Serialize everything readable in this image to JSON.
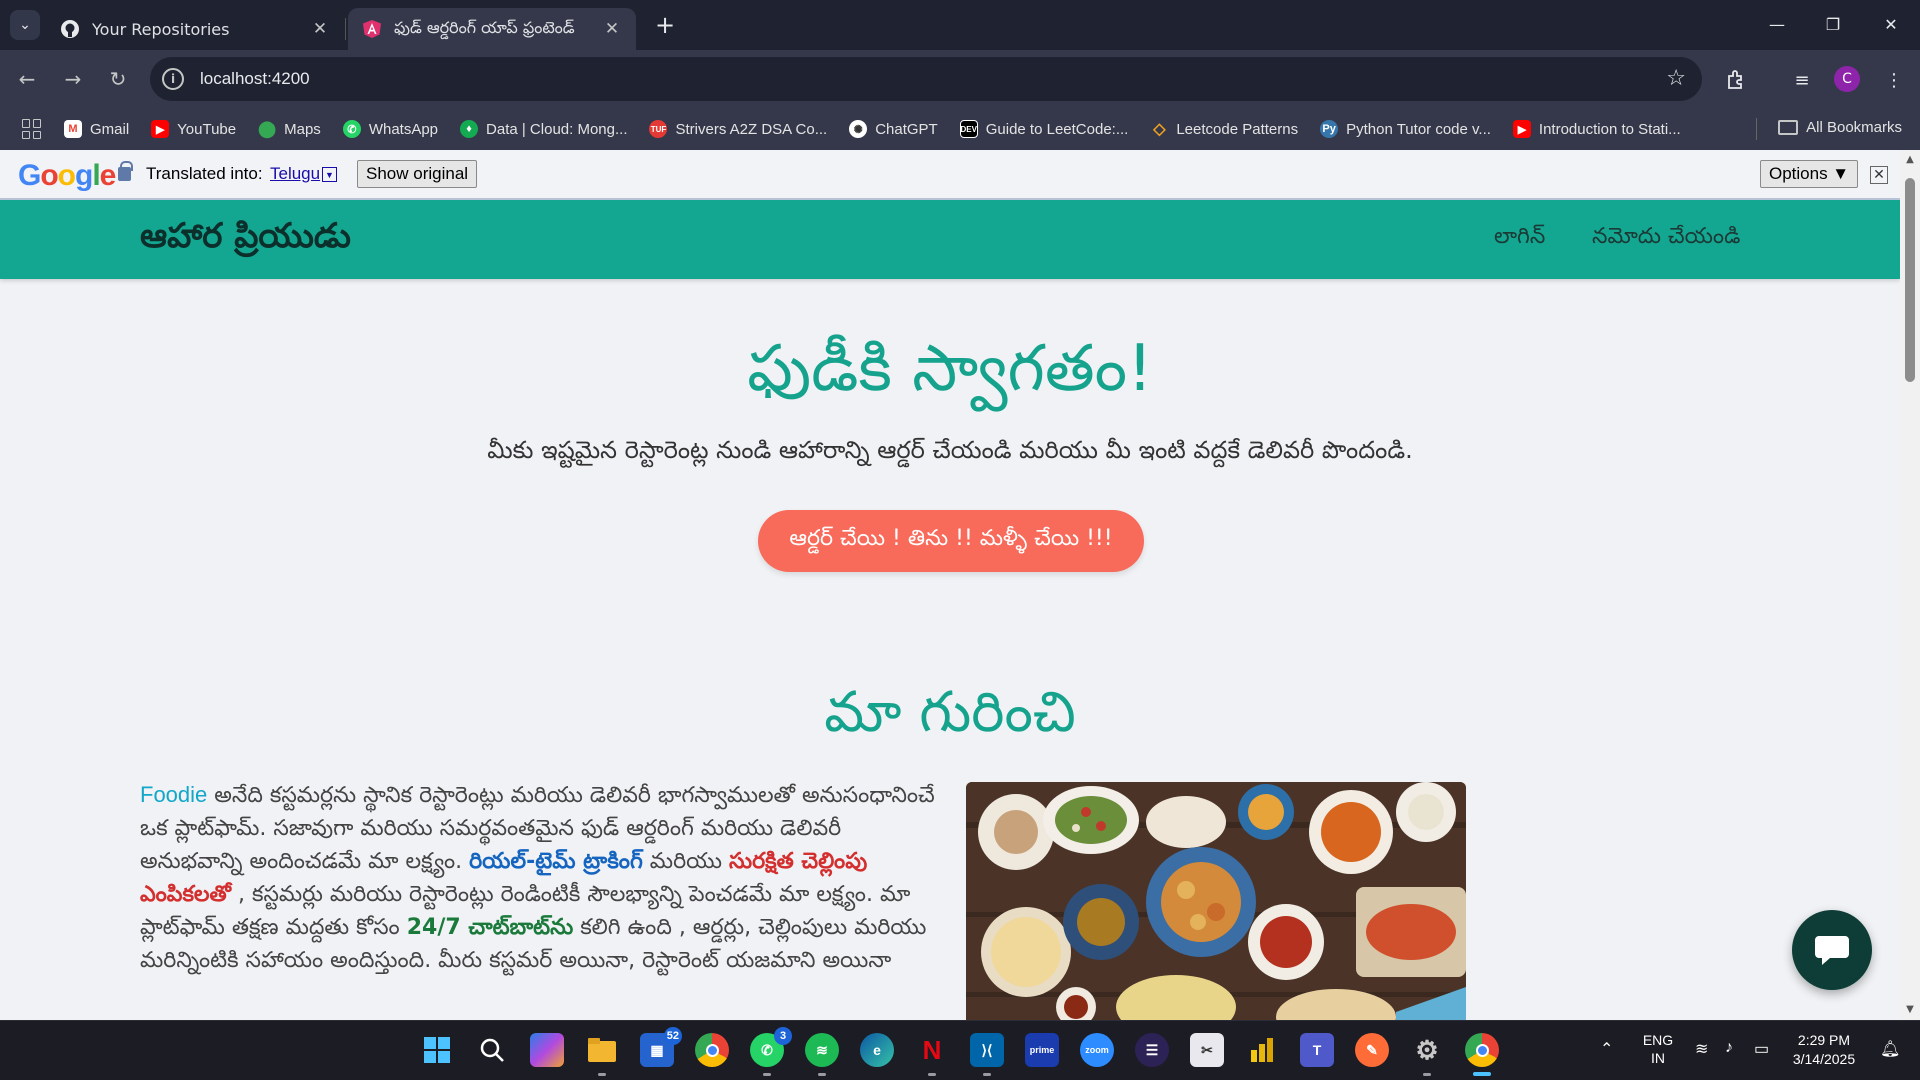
{
  "browser": {
    "tabs": [
      {
        "title": "Your Repositories",
        "icon": "github-icon"
      },
      {
        "title": "ఫుడ్ ఆర్డరింగ్ యాప్ ఫ్రంటెండ్",
        "icon": "angular-icon"
      }
    ],
    "url": "localhost:4200",
    "profile_initial": "C",
    "bookmarks": [
      {
        "label": "Gmail",
        "icon": "gmail-icon",
        "color": "#ea4335"
      },
      {
        "label": "YouTube",
        "icon": "youtube-icon",
        "color": "#ff0000"
      },
      {
        "label": "Maps",
        "icon": "maps-icon",
        "color": "#34a853"
      },
      {
        "label": "WhatsApp",
        "icon": "whatsapp-icon",
        "color": "#25d366"
      },
      {
        "label": "Data | Cloud: Mong...",
        "icon": "mongodb-icon",
        "color": "#13aa52"
      },
      {
        "label": "Strivers A2Z DSA Co...",
        "icon": "tuf-icon",
        "color": "#e53935"
      },
      {
        "label": "ChatGPT",
        "icon": "chatgpt-icon",
        "color": "#444444"
      },
      {
        "label": "Guide to LeetCode:...",
        "icon": "dev-icon",
        "color": "#000000"
      },
      {
        "label": "Leetcode Patterns",
        "icon": "leetcode-icon",
        "color": "#f0a020"
      },
      {
        "label": "Python Tutor code v...",
        "icon": "python-icon",
        "color": "#3776ab"
      },
      {
        "label": "Introduction to Stati...",
        "icon": "youtube-icon",
        "color": "#ff0000"
      }
    ],
    "all_bookmarks": "All Bookmarks"
  },
  "translate_bar": {
    "label": "Translated into:",
    "language": "Telugu",
    "show_original": "Show original",
    "options": "Options ▼"
  },
  "site": {
    "brand": "ఆహార ప్రియుడు",
    "nav": {
      "login": "లాగిన్",
      "register": "నమోదు చేయండి"
    },
    "hero": {
      "title": "ఫుడీకి స్వాగతం!",
      "subtitle": "మీకు ఇష్టమైన రెస్టారెంట్ల నుండి ఆహారాన్ని ఆర్డర్ చేయండి మరియు మీ ఇంటి వద్దకే డెలివరీ పొందండి.",
      "cta": "ఆర్డర్ చేయి ! తిను !! మళ్ళీ చేయి !!!"
    },
    "about": {
      "title": "మా గురించి",
      "brand_word": "Foodie",
      "p1": " అనేది కస్టమర్లను స్థానిక రెస్టారెంట్లు మరియు డెలివరీ భాగస్వాములతో అనుసంధానించే ఒక ప్లాట్‌ఫామ్. సజావుగా మరియు సమర్థవంతమైన ఫుడ్ ఆర్డరింగ్ మరియు డెలివరీ అనుభవాన్ని అందించడమే మా లక్ష్యం. ",
      "hl1": "రియల్-టైమ్ ట్రాకింగ్",
      "p2": " మరియు ",
      "hl2": "సురక్షిత చెల్లింపు ఎంపికలతో",
      "p3": " , కస్టమర్లు మరియు రెస్టారెంట్లు రెండింటికీ సౌలభ్యాన్ని పెంచడమే మా లక్ష్యం. మా ప్లాట్‌ఫామ్ తక్షణ మద్దతు కోసం ",
      "hl3": "24/7 చాట్‌బాట్‌ను",
      "p4": " కలిగి ఉంది , ఆర్డర్లు, చెల్లింపులు మరియు మరిన్నింటికి సహాయం అందిస్తుంది. మీరు కస్టమర్ అయినా, రెస్టారెంట్ యజమాని అయినా"
    }
  },
  "taskbar": {
    "teams_badge": "52",
    "whatsapp_badge": "3",
    "lang_top": "ENG",
    "lang_bottom": "IN",
    "time": "2:29 PM",
    "date": "3/14/2025"
  }
}
